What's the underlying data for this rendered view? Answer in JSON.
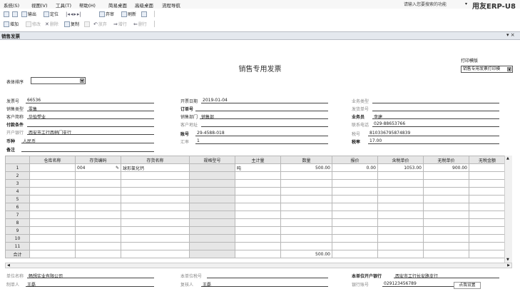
{
  "menubar": {
    "items": [
      "系统(S)",
      "视图(V)",
      "工具(T)",
      "帮助(H)",
      "简易桌面",
      "高级桌面",
      "流程导航"
    ],
    "search_placeholder": "请输入您要搜索的功能",
    "brand": "用友ERP-U8"
  },
  "toolbar1": {
    "items": [
      "输出",
      "定位",
      "弃审",
      "刷新"
    ]
  },
  "toolbar2": {
    "items": [
      "增加",
      "修改",
      "删除",
      "复制",
      "放弃",
      "增行",
      "删行"
    ]
  },
  "tab": {
    "label": "销售发票",
    "close": "▾ ×"
  },
  "form": {
    "title": "销售专用发票",
    "print_template_label": "打印模版",
    "print_template_value": "销售专用发票打印模",
    "sort_label": "表体排序",
    "sort_value": "",
    "fields": {
      "invoice_no": {
        "label": "发票号",
        "value": "66536"
      },
      "invoice_date": {
        "label": "开票日期",
        "value": "2019-01-04"
      },
      "business_type": {
        "label": "业务类型",
        "value": ""
      },
      "sales_type": {
        "label": "销售类型",
        "value": "零售"
      },
      "order_no": {
        "label": "订单号",
        "value": ""
      },
      "delivery_no": {
        "label": "发货单号",
        "value": ""
      },
      "customer": {
        "label": "客户简称",
        "value": "华怡塑业"
      },
      "sales_dept": {
        "label": "销售部门",
        "value": "销售部"
      },
      "salesperson": {
        "label": "业务员",
        "value": "李建"
      },
      "payment_terms": {
        "label": "付款条件",
        "value": ""
      },
      "customer_addr": {
        "label": "客户地址",
        "value": ""
      },
      "phone": {
        "label": "联系电话",
        "value": "029-88653766"
      },
      "bank": {
        "label": "开户银行",
        "value": "西安市工行西稍门支行"
      },
      "account": {
        "label": "账号",
        "value": "29-4588-018"
      },
      "tax_no": {
        "label": "税号",
        "value": "810336795874839"
      },
      "currency": {
        "label": "币种",
        "value": "人民币"
      },
      "rate": {
        "label": "汇率",
        "value": "1"
      },
      "tax_rate": {
        "label": "税率",
        "value": "17.00"
      },
      "remark": {
        "label": "备注",
        "value": ""
      }
    }
  },
  "grid": {
    "columns": [
      "",
      "仓库名称",
      "存货编码",
      "存货名称",
      "规格型号",
      "主计量",
      "数量",
      "报价",
      "含税单价",
      "无税单价",
      "无税金额"
    ],
    "rows": [
      [
        "1",
        "",
        "004",
        "球形氯化钙",
        "",
        "吨",
        "500.00",
        "0.00",
        "1053.00",
        "900.00",
        ""
      ],
      [
        "2",
        "",
        "",
        "",
        "",
        "",
        "",
        "",
        "",
        "",
        ""
      ],
      [
        "3",
        "",
        "",
        "",
        "",
        "",
        "",
        "",
        "",
        "",
        ""
      ],
      [
        "4",
        "",
        "",
        "",
        "",
        "",
        "",
        "",
        "",
        "",
        ""
      ],
      [
        "5",
        "",
        "",
        "",
        "",
        "",
        "",
        "",
        "",
        "",
        ""
      ],
      [
        "6",
        "",
        "",
        "",
        "",
        "",
        "",
        "",
        "",
        "",
        ""
      ],
      [
        "7",
        "",
        "",
        "",
        "",
        "",
        "",
        "",
        "",
        "",
        ""
      ],
      [
        "8",
        "",
        "",
        "",
        "",
        "",
        "",
        "",
        "",
        "",
        ""
      ],
      [
        "9",
        "",
        "",
        "",
        "",
        "",
        "",
        "",
        "",
        "",
        ""
      ],
      [
        "10",
        "",
        "",
        "",
        "",
        "",
        "",
        "",
        "",
        "",
        ""
      ],
      [
        "11",
        "",
        "",
        "",
        "",
        "",
        "",
        "",
        "",
        "",
        ""
      ]
    ],
    "total_label": "合计",
    "total_qty": "500.00"
  },
  "footer": {
    "unit_name": {
      "label": "单位名称",
      "value": "畅想实业有限公司"
    },
    "unit_tax": {
      "label": "本单位税号",
      "value": ""
    },
    "unit_bank": {
      "label": "本单位开户银行",
      "value": "西安市工行长安路支行"
    },
    "maker": {
      "label": "制单人",
      "value": "王磊"
    },
    "reviewer": {
      "label": "复核人",
      "value": "王磊"
    },
    "bank_account": {
      "label": "银行账号",
      "value": "029123456789"
    }
  },
  "tooltip": "点我设置"
}
